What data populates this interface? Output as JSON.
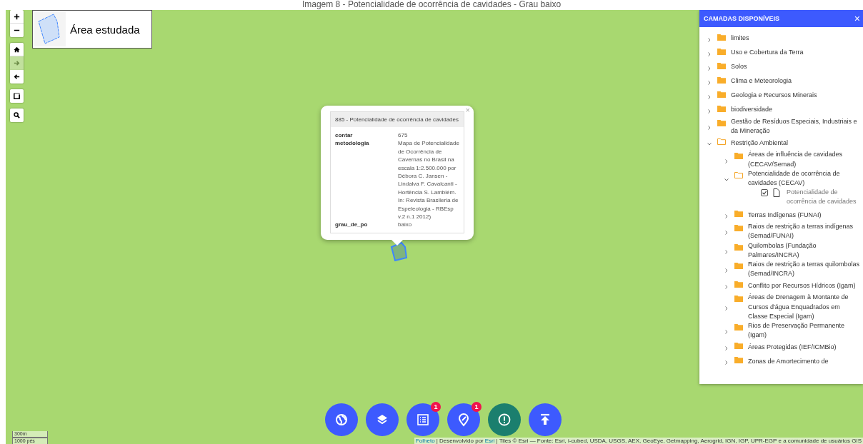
{
  "caption": "Imagem 8 - Potencialidade de ocorrência de cavidades - Grau baixo",
  "map_controls": [
    {
      "disabled": false
    },
    {
      "disabled": false
    },
    {
      "disabled": false
    },
    {
      "disabled": true
    },
    {
      "disabled": false
    },
    {
      "disabled": false
    },
    {
      "disabled": false
    }
  ],
  "legend": {
    "label": "Área estudada"
  },
  "popup": {
    "close": "×",
    "title": "885 - Potencialidade de ocorrência de cavidades",
    "rows": [
      {
        "label": "contar",
        "value": "675"
      },
      {
        "label": "metodologia",
        "value": "Mapa de Potencialidade de Ocorrência de Cavernas no Brasil na escala 1:2.500.000 por Débora C. Jansen - Lindalva F. Cavalcanti - Hortência S. Lamblém. In: Revista Brasileria de Espeleologia - RBEsp v.2 n.1 2012)"
      },
      {
        "label": "grau_de_po",
        "value": "baixo"
      }
    ]
  },
  "layers_panel": {
    "title": "CAMADAS DISPONÍVEIS",
    "close": "×",
    "items": [
      {
        "kind": "folder",
        "label": "limites",
        "expanded": false
      },
      {
        "kind": "folder",
        "label": "Uso e Cobertura da Terra",
        "expanded": false
      },
      {
        "kind": "folder",
        "label": "Solos",
        "expanded": false
      },
      {
        "kind": "folder",
        "label": "Clima e Meteorologia",
        "expanded": false
      },
      {
        "kind": "folder",
        "label": "Geologia e Recursos Minerais",
        "expanded": false
      },
      {
        "kind": "folder",
        "label": "biodiversidade",
        "expanded": false
      },
      {
        "kind": "folder",
        "label": "Gestão de Resíduos Especiais, Industriais e da Mineração",
        "expanded": false
      },
      {
        "kind": "folder",
        "label": "Restrição Ambiental",
        "expanded": true,
        "children": [
          {
            "kind": "folder",
            "label": "Áreas de influência de cavidades (CECAV/Semad)",
            "expanded": false
          },
          {
            "kind": "folder",
            "label": "Potencialidade de ocorrência de cavidades (CECAV)",
            "expanded": true,
            "children": [
              {
                "kind": "layer",
                "label": "Potencialidade de ocorrência de cavidades",
                "checked": true
              }
            ]
          },
          {
            "kind": "folder",
            "label": "Terras Indígenas (FUNAI)",
            "expanded": false
          },
          {
            "kind": "folder",
            "label": "Raios de restrição a terras indígenas (Semad/FUNAI)",
            "expanded": false
          },
          {
            "kind": "folder",
            "label": "Quilombolas (Fundação Palmares/INCRA)",
            "expanded": false
          },
          {
            "kind": "folder",
            "label": "Raios de restrição a terras quilombolas (Semad/INCRA)",
            "expanded": false
          },
          {
            "kind": "folder",
            "label": "Conflito por Recursos Hídricos (Igam)",
            "expanded": false
          },
          {
            "kind": "folder",
            "label": "Áreas de Drenagem à Montante de Cursos d'água Enquadrados em Classe Especial (Igam)",
            "expanded": false
          },
          {
            "kind": "folder",
            "label": "Rios de Preservação Permanente (Igam)",
            "expanded": false
          },
          {
            "kind": "folder",
            "label": "Áreas Protegidas (IEF/ICMBio)",
            "expanded": false
          },
          {
            "kind": "folder",
            "label": "Zonas de Amortecimento de",
            "expanded": false
          }
        ]
      }
    ]
  },
  "action_buttons": [
    {
      "color": "#3d5afe"
    },
    {
      "color": "#3d5afe"
    },
    {
      "color": "#3d5afe",
      "badge": "1"
    },
    {
      "color": "#3d5afe",
      "badge": "1"
    },
    {
      "color": "#1b7f6e"
    },
    {
      "color": "#3d5afe"
    }
  ],
  "scale": {
    "metric": "300m",
    "imperial": "1000 pés"
  },
  "attribution": {
    "leaflet": "Folheto",
    "text_1": "| Desenvolvido por",
    "esri": "Esri",
    "text_2": "| Tiles © Esri — Fonte: Esri, i-cubed, USDA, USGS, AEX, GeoEye, Getmapping, Aerogrid, IGN, IGP, UPR-EGP e a comunidade de usuários GIS"
  }
}
